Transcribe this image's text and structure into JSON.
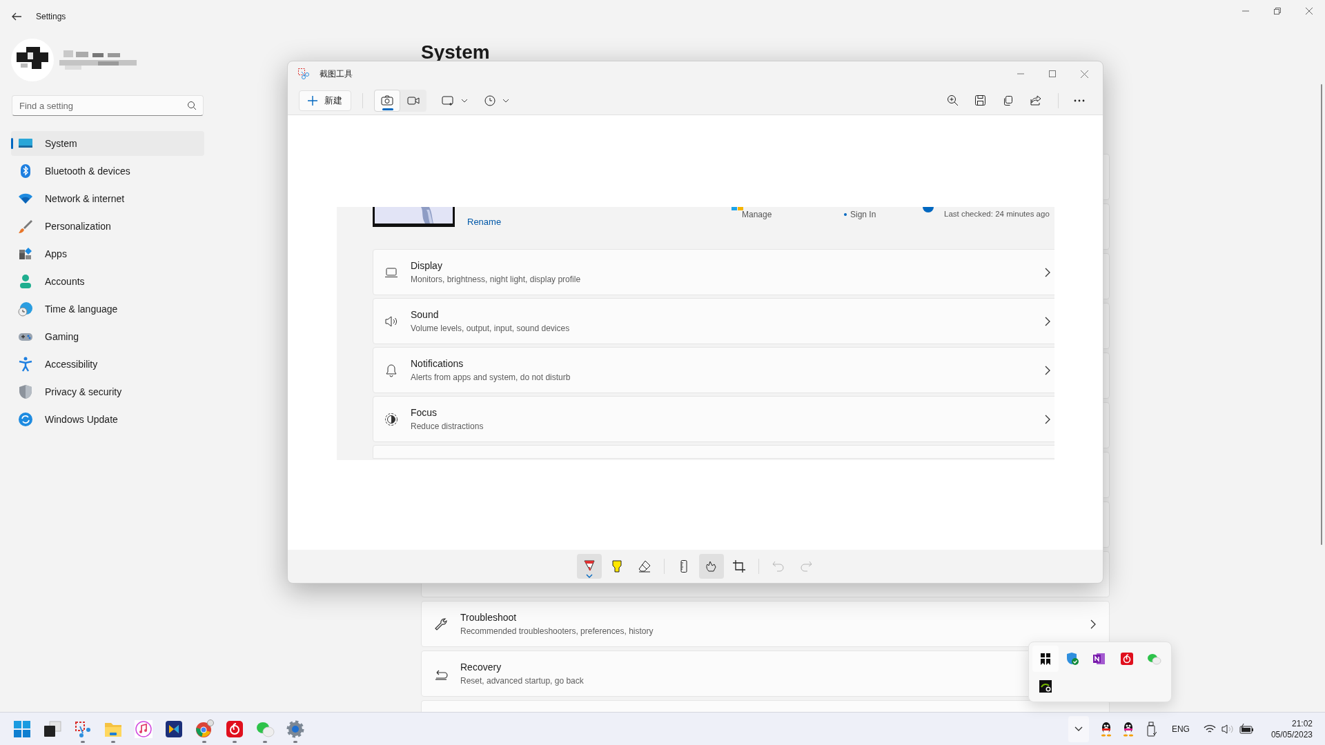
{
  "settings": {
    "title": "Settings",
    "search": {
      "placeholder": "Find a setting"
    },
    "nav": [
      {
        "label": "System",
        "selected": true
      },
      {
        "label": "Bluetooth & devices",
        "selected": false
      },
      {
        "label": "Network & internet",
        "selected": false
      },
      {
        "label": "Personalization",
        "selected": false
      },
      {
        "label": "Apps",
        "selected": false
      },
      {
        "label": "Accounts",
        "selected": false
      },
      {
        "label": "Time & language",
        "selected": false
      },
      {
        "label": "Gaming",
        "selected": false
      },
      {
        "label": "Accessibility",
        "selected": false
      },
      {
        "label": "Privacy & security",
        "selected": false
      },
      {
        "label": "Windows Update",
        "selected": false
      }
    ],
    "heading": "System",
    "cards": [
      {
        "title": "Troubleshoot",
        "subtitle": "Recommended troubleshooters, preferences, history"
      },
      {
        "title": "Recovery",
        "subtitle": "Reset, advanced startup, go back"
      }
    ]
  },
  "snipping_tool": {
    "title": "截图工具",
    "new_button": "新建",
    "capture_modes": [
      {
        "selected": true
      },
      {
        "selected": false
      }
    ],
    "markup_tools": [
      {
        "selected": true,
        "disabled": false
      },
      {
        "selected": false,
        "disabled": false
      },
      {
        "selected": false,
        "disabled": false
      },
      {
        "selected": false,
        "disabled": false
      },
      {
        "selected": true,
        "disabled": false
      },
      {
        "selected": false,
        "disabled": false
      },
      {
        "selected": false,
        "disabled": true
      },
      {
        "selected": false,
        "disabled": true
      }
    ]
  },
  "captured_image": {
    "rename_link": "Rename",
    "manage_label": "Manage",
    "sign_in_label": "Sign In",
    "last_checked": "Last checked: 24 minutes ago",
    "cards": [
      {
        "title": "Display",
        "subtitle": "Monitors, brightness, night light, display profile"
      },
      {
        "title": "Sound",
        "subtitle": "Volume levels, output, input, sound devices"
      },
      {
        "title": "Notifications",
        "subtitle": "Alerts from apps and system, do not disturb"
      },
      {
        "title": "Focus",
        "subtitle": "Reduce distractions"
      }
    ]
  },
  "taskbar": {
    "language": "ENG",
    "time": "21:02",
    "date": "05/05/2023"
  }
}
